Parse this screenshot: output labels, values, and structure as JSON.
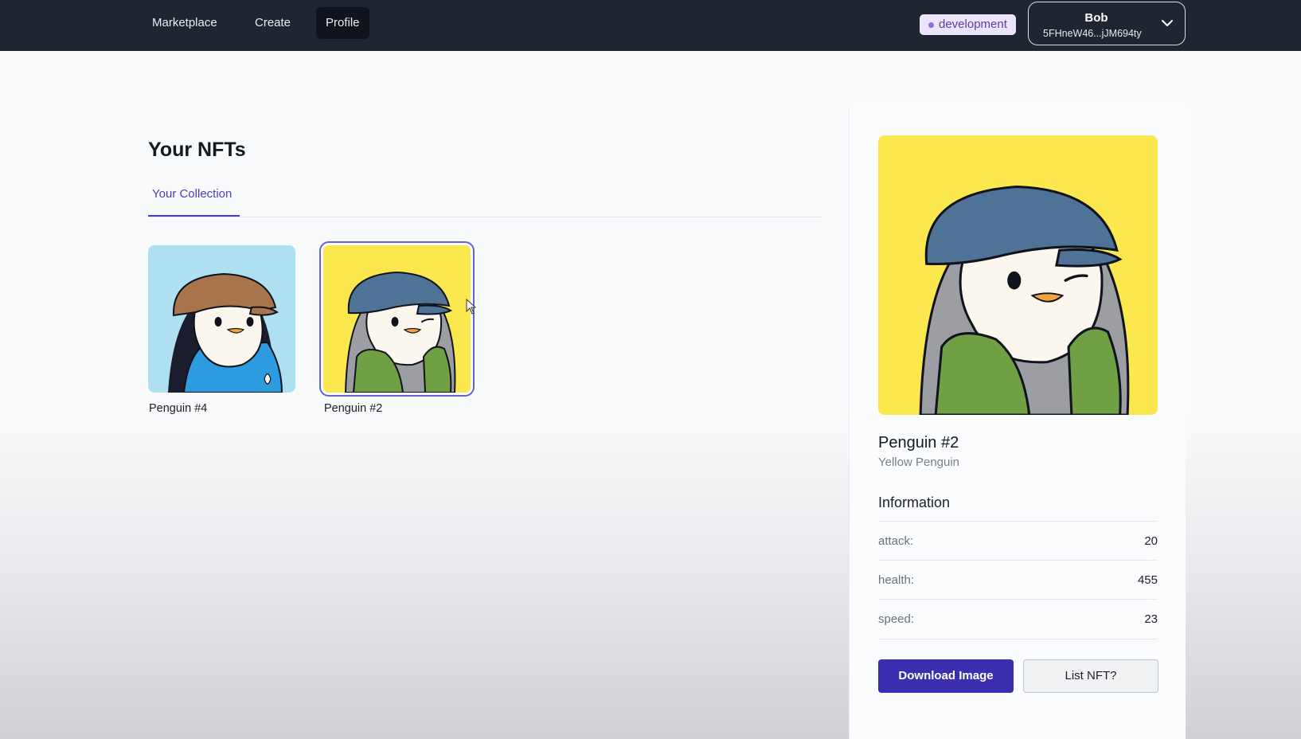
{
  "nav": {
    "links": [
      {
        "label": "Marketplace"
      },
      {
        "label": "Create"
      },
      {
        "label": "Profile",
        "active": true
      }
    ],
    "env_badge": "development",
    "account": {
      "name": "Bob",
      "address": "5FHneW46...jJM694ty"
    }
  },
  "main": {
    "title": "Your NFTs",
    "tab": "Your Collection",
    "nfts": [
      {
        "name": "Penguin #4",
        "background": "#aee0f1",
        "selected": false
      },
      {
        "name": "Penguin #2",
        "background": "#fbe74e",
        "selected": true
      }
    ]
  },
  "detail": {
    "name": "Penguin #2",
    "subtitle": "Yellow Penguin",
    "info_title": "Information",
    "attributes": [
      {
        "key": "attack:",
        "value": "20"
      },
      {
        "key": "health:",
        "value": "455"
      },
      {
        "key": "speed:",
        "value": "23"
      }
    ],
    "download_label": "Download Image",
    "list_label": "List NFT?"
  },
  "colors": {
    "nav_bg": "#1f2531",
    "accent": "#3b2fb0",
    "badge_bg": "#ece4fb"
  }
}
